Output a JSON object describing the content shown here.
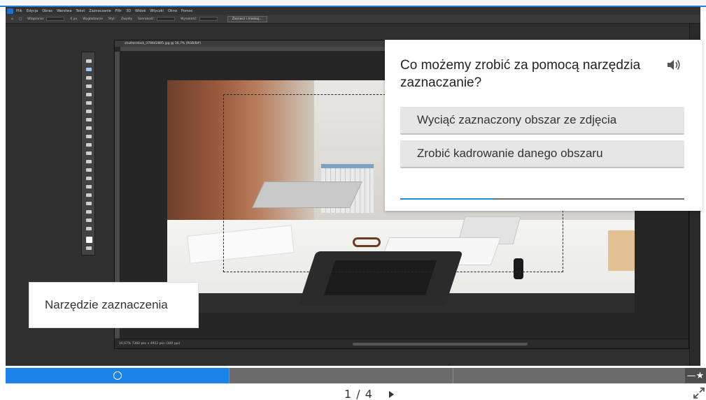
{
  "photoshop": {
    "menu": [
      "Plik",
      "Edycja",
      "Obraz",
      "Warstwa",
      "Tekst",
      "Zaznaczanie",
      "Filtr",
      "3D",
      "Widok",
      "Wtyczki",
      "Okno",
      "Pomoc"
    ],
    "options": {
      "feather_label": "Wtapianie:",
      "feather_value": "0 px",
      "antialias_label": "Wygładzanie",
      "style_label": "Styl:",
      "style_value": "Zwykły",
      "width_label": "Szerokość:",
      "height_label": "Wysokość:",
      "select_mask_button": "Zaznacz i maskuj..."
    },
    "document": {
      "tab_title": "shutterstock_378642805.jpg @ 16,7% (RGB/8#)",
      "status": "16,67%    7360 pks x 4912 pks (300 ppi)"
    }
  },
  "caption": {
    "text": "Narzędzie zaznaczenia"
  },
  "quiz": {
    "question": "Co możemy zrobić za pomocą narzędzia zaznaczanie?",
    "speaker_icon": "speaker-icon",
    "answers": [
      "Wyciąć zaznaczony obszar ze zdjęcia",
      "Zrobić kadrowanie danego obszaru"
    ],
    "progress": 0.33,
    "progress_color": "#1a8fd8"
  },
  "player": {
    "current_page": "1",
    "total_pages": "4",
    "pager_text": "1 / 4",
    "active_color": "#1a82e8",
    "segment_progress": 0.32,
    "segments": 3
  }
}
